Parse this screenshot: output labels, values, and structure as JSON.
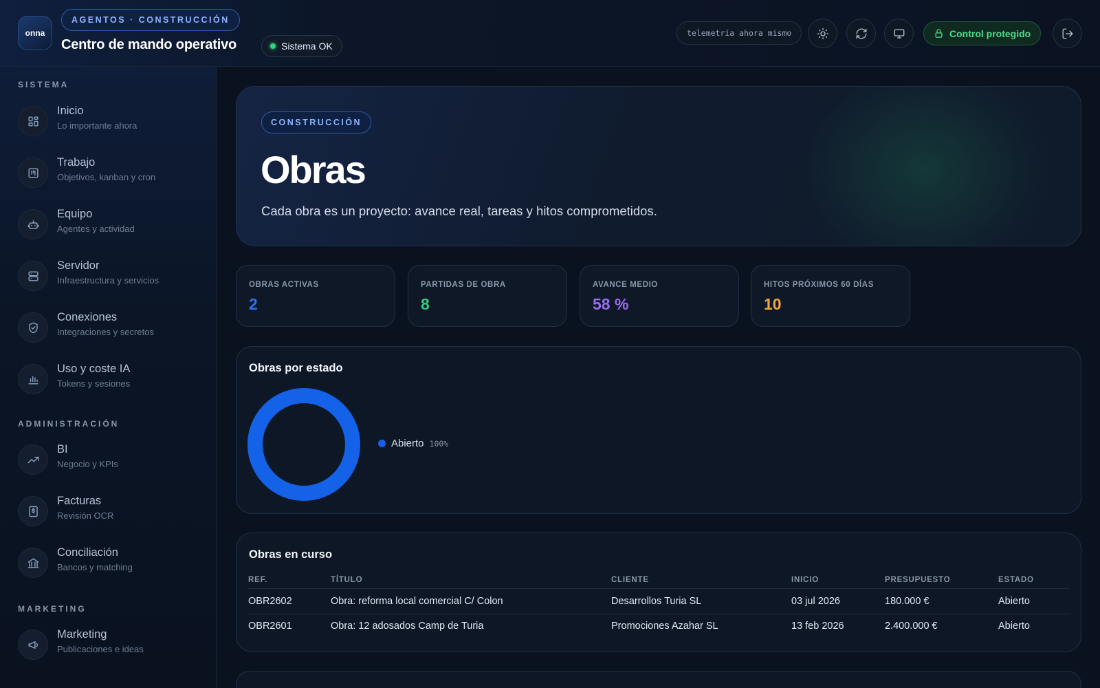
{
  "header": {
    "logo_text": "onna",
    "kicker": "AGENTOS · CONSTRUCCIÓN",
    "title": "Centro de mando operativo",
    "status": "Sistema OK",
    "telemetry": "telemetría ahora mismo",
    "control": "Control protegido",
    "icons": [
      "sun-icon",
      "refresh-icon",
      "monitor-icon",
      "logout-icon"
    ]
  },
  "sidebar": {
    "sections": [
      {
        "title": "SISTEMA",
        "items": [
          {
            "label": "Inicio",
            "sub": "Lo importante ahora",
            "icon": "dashboard-icon"
          },
          {
            "label": "Trabajo",
            "sub": "Objetivos, kanban y cron",
            "icon": "kanban-icon"
          },
          {
            "label": "Equipo",
            "sub": "Agentes y actividad",
            "icon": "robot-icon"
          },
          {
            "label": "Servidor",
            "sub": "Infraestructura y servicios",
            "icon": "server-icon"
          },
          {
            "label": "Conexiones",
            "sub": "Integraciones y secretos",
            "icon": "shield-icon"
          },
          {
            "label": "Uso y coste IA",
            "sub": "Tokens y sesiones",
            "icon": "bar-chart-icon"
          }
        ]
      },
      {
        "title": "ADMINISTRACIÓN",
        "items": [
          {
            "label": "BI",
            "sub": "Negocio y KPIs",
            "icon": "trend-icon"
          },
          {
            "label": "Facturas",
            "sub": "Revisión OCR",
            "icon": "invoice-icon"
          },
          {
            "label": "Conciliación",
            "sub": "Bancos y matching",
            "icon": "bank-icon"
          }
        ]
      },
      {
        "title": "MARKETING",
        "items": [
          {
            "label": "Marketing",
            "sub": "Publicaciones e ideas",
            "icon": "megaphone-icon"
          }
        ]
      }
    ]
  },
  "hero": {
    "kicker": "CONSTRUCCIÓN",
    "title": "Obras",
    "description": "Cada obra es un proyecto: avance real, tareas y hitos comprometidos."
  },
  "kpis": [
    {
      "label": "OBRAS ACTIVAS",
      "value": "2",
      "color": "#2f6fe8"
    },
    {
      "label": "PARTIDAS DE OBRA",
      "value": "8",
      "color": "#37c97f"
    },
    {
      "label": "AVANCE MEDIO",
      "value": "58 %",
      "color": "#9a6bf0"
    },
    {
      "label": "HITOS PRÓXIMOS 60 DÍAS",
      "value": "10",
      "color": "#f0a63a"
    }
  ],
  "status_card": {
    "title": "Obras por estado"
  },
  "chart_data": {
    "type": "pie",
    "variant": "donut",
    "categories": [
      "Abierto"
    ],
    "values": [
      100
    ],
    "value_labels": [
      "100%"
    ],
    "colors": [
      "#1462e8"
    ]
  },
  "table": {
    "title": "Obras en curso",
    "columns": [
      "REF.",
      "TÍTULO",
      "CLIENTE",
      "INICIO",
      "PRESUPUESTO",
      "ESTADO"
    ],
    "rows": [
      [
        "OBR2602",
        "Obra: reforma local comercial C/ Colon",
        "Desarrollos Turia SL",
        "03 jul 2026",
        "180.000 €",
        "Abierto"
      ],
      [
        "OBR2601",
        "Obra: 12 adosados Camp de Turia",
        "Promociones Azahar SL",
        "13 feb 2026",
        "2.400.000 €",
        "Abierto"
      ]
    ]
  }
}
